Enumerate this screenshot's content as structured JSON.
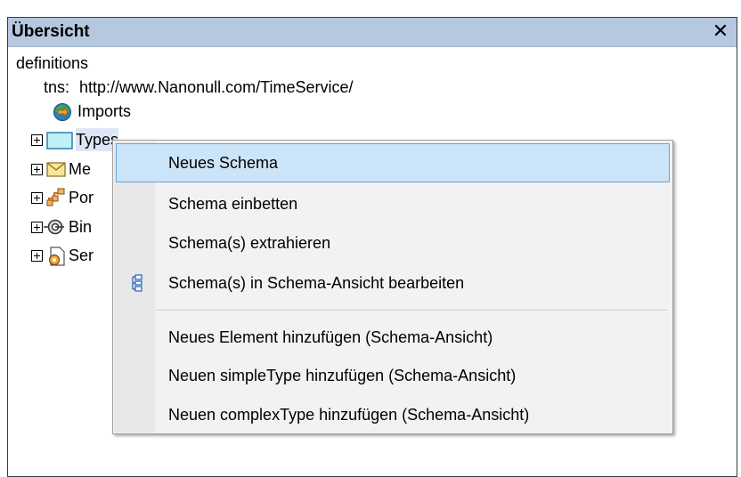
{
  "panel": {
    "title": "Übersicht",
    "close_label": "✕"
  },
  "tree": {
    "root_label": "definitions",
    "tns_label": "tns:",
    "tns_value": "http://www.Nanonull.com/TimeService/",
    "imports_label": "Imports",
    "items": [
      {
        "label": "Types",
        "icon": "types-icon"
      },
      {
        "label": "Me",
        "icon": "messages-icon"
      },
      {
        "label": "Por",
        "icon": "porttypes-icon"
      },
      {
        "label": "Bin",
        "icon": "bindings-icon"
      },
      {
        "label": "Ser",
        "icon": "services-icon"
      }
    ]
  },
  "context_menu": {
    "items": [
      {
        "label": "Neues Schema",
        "highlighted": true
      },
      {
        "label": "Schema einbetten"
      },
      {
        "label": "Schema(s) extrahieren"
      },
      {
        "label": "Schema(s) in Schema-Ansicht bearbeiten",
        "icon": "schema-view-icon"
      },
      {
        "label": "Neues Element hinzufügen (Schema-Ansicht)"
      },
      {
        "label": "Neuen simpleType hinzufügen (Schema-Ansicht)"
      },
      {
        "label": "Neuen complexType hinzufügen (Schema-Ansicht)"
      }
    ]
  },
  "colors": {
    "titlebar": "#b6c8df",
    "highlight_fill": "#cce4f7",
    "highlight_border": "#5fa7e5",
    "menu_background": "#f2f2f2"
  }
}
